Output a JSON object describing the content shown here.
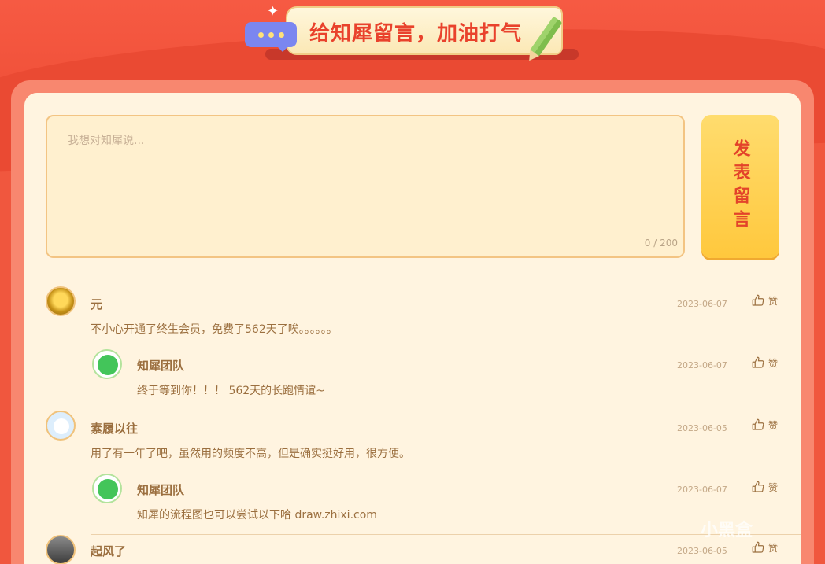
{
  "banner": {
    "title": "给知犀留言，加油打气"
  },
  "composer": {
    "placeholder": "我想对知犀说...",
    "counter": "0 / 200",
    "post_button_label": "发表留言"
  },
  "comments": [
    {
      "name": "元",
      "text": "不小心开通了终生会员，免费了562天了唉。。。。。。",
      "date": "2023-06-07",
      "like_label": "赞",
      "reply": {
        "name": "知犀团队",
        "text": "终于等到你！！！ 562天的长跑情谊~",
        "date": "2023-06-07",
        "like_label": "赞"
      }
    },
    {
      "name": "素履以往",
      "text": "用了有一年了吧，虽然用的频度不高，但是确实挺好用，很方便。",
      "date": "2023-06-05",
      "like_label": "赞",
      "reply": {
        "name": "知犀团队",
        "text": "知犀的流程图也可以尝试以下哈 draw.zhixi.com",
        "date": "2023-06-07",
        "like_label": "赞"
      }
    },
    {
      "name": "起风了",
      "text": "",
      "date": "2023-06-05",
      "like_label": "赞"
    }
  ],
  "watermark": "小黑盒",
  "colors": {
    "accent_red": "#e3432a",
    "button_yellow": "#ffc83d",
    "panel_bg": "#fff4e0",
    "text_brown": "#9b6f3f"
  }
}
